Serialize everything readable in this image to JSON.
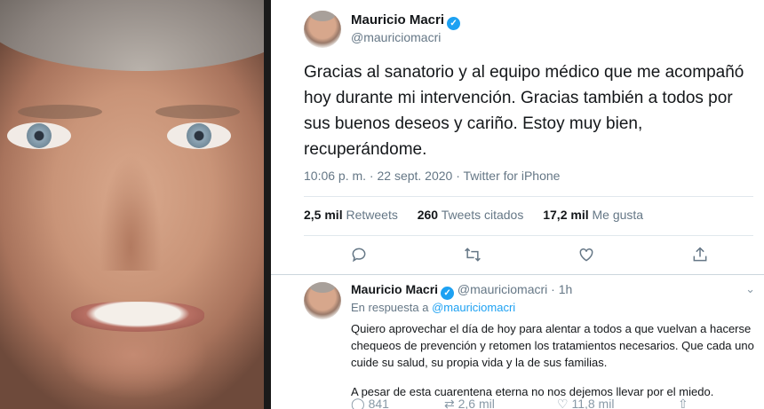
{
  "tweet": {
    "author_name": "Mauricio Macri",
    "handle": "@mauriciomacri",
    "text": "Gracias al sanatorio y al equipo médico que me acompañó hoy durante mi intervención. Gracias también a todos por sus buenos deseos y cariño. Estoy muy bien, recuperándome.",
    "meta": "10:06 p. m. · 22 sept. 2020 · Twitter for iPhone",
    "stats": {
      "retweets_value": "2,5 mil",
      "retweets_label": "Retweets",
      "quotes_value": "260",
      "quotes_label": "Tweets citados",
      "likes_value": "17,2 mil",
      "likes_label": "Me gusta"
    },
    "actions": {
      "reply_icon": "comment-icon",
      "retweet_icon": "retweet-icon",
      "like_icon": "heart-icon",
      "share_icon": "share-icon"
    }
  },
  "reply": {
    "author_name": "Mauricio Macri",
    "handle": "@mauriciomacri",
    "time": "· 1h",
    "in_reply_prefix": "En respuesta a",
    "in_reply_handle": "@mauriciomacri",
    "paragraph1": "Quiero aprovechar el día de hoy para alentar a todos a que vuelvan a hacerse chequeos de prevención y retomen los tratamientos necesarios. Que cada uno cuide su salud, su propia vida y la de sus familias.",
    "paragraph2": "A pesar de esta cuarentena eterna no nos dejemos llevar por el miedo.",
    "counts": {
      "replies": "841",
      "retweets": "2,6 mil",
      "likes": "11,8 mil"
    }
  },
  "colors": {
    "accent": "#1da1f2",
    "muted": "#657786",
    "divider": "#e1e8ed"
  }
}
